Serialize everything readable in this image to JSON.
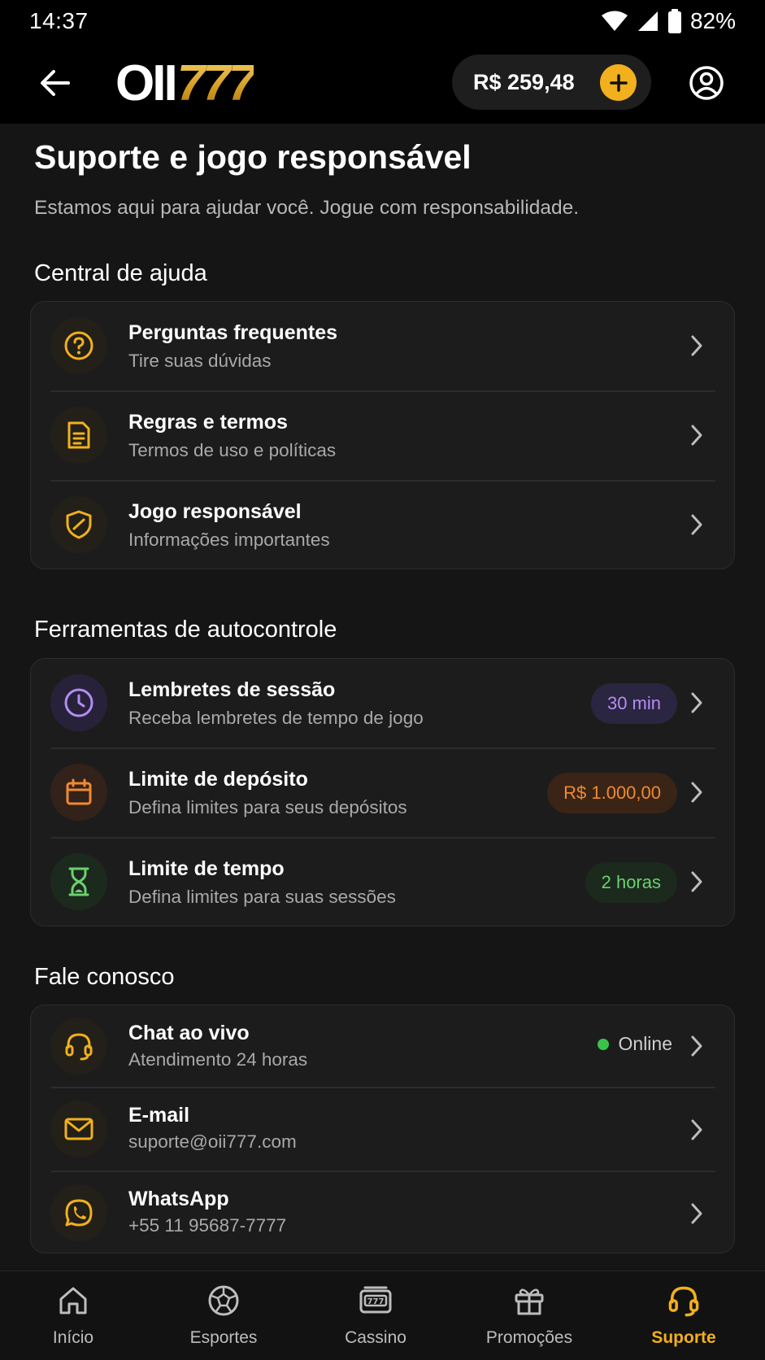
{
  "status_bar": {
    "time": "14:37",
    "battery": "82%"
  },
  "header": {
    "logo_white": "OII",
    "logo_gold": "777",
    "balance": "R$ 259,48"
  },
  "page": {
    "title": "Suporte e jogo responsável",
    "subtitle": "Estamos aqui para ajudar você. Jogue com responsabilidade."
  },
  "help_center": {
    "title": "Central de ajuda",
    "items": [
      {
        "title": "Perguntas frequentes",
        "subtitle": "Tire suas dúvidas",
        "icon": "question-circle-icon"
      },
      {
        "title": "Regras e termos",
        "subtitle": "Termos de uso e políticas",
        "icon": "document-icon"
      },
      {
        "title": "Jogo responsável",
        "subtitle": "Informações importantes",
        "icon": "shield-check-icon"
      }
    ]
  },
  "self_control": {
    "title": "Ferramentas de autocontrole",
    "items": [
      {
        "title": "Lembretes de sessão",
        "subtitle": "Receba lembretes de tempo de jogo",
        "badge": "30 min",
        "icon": "clock-icon",
        "color": "#b58cf2"
      },
      {
        "title": "Limite de depósito",
        "subtitle": "Defina limites para seus depósitos",
        "badge": "R$ 1.000,00",
        "icon": "calendar-icon",
        "color": "#f08a32"
      },
      {
        "title": "Limite de tempo",
        "subtitle": "Defina limites para suas sessões",
        "badge": "2 horas",
        "icon": "hourglass-icon",
        "color": "#6bd06f"
      }
    ]
  },
  "contact": {
    "title": "Fale conosco",
    "items": [
      {
        "title": "Chat ao vivo",
        "subtitle": "Atendimento 24 horas",
        "status": "Online",
        "icon": "headset-icon"
      },
      {
        "title": "E-mail",
        "subtitle": "suporte@oii777.com",
        "icon": "mail-icon"
      },
      {
        "title": "WhatsApp",
        "subtitle": "+55 11 95687-7777",
        "icon": "whatsapp-icon"
      }
    ]
  },
  "bottom_nav": {
    "items": [
      {
        "label": "Início",
        "icon": "home-icon"
      },
      {
        "label": "Esportes",
        "icon": "soccer-ball-icon"
      },
      {
        "label": "Cassino",
        "icon": "slot-machine-icon"
      },
      {
        "label": "Promoções",
        "icon": "gift-icon"
      },
      {
        "label": "Suporte",
        "icon": "headset-icon",
        "active": true
      }
    ]
  },
  "colors": {
    "accent": "#f2b01e",
    "background": "#151515",
    "card": "#1c1c1c"
  }
}
